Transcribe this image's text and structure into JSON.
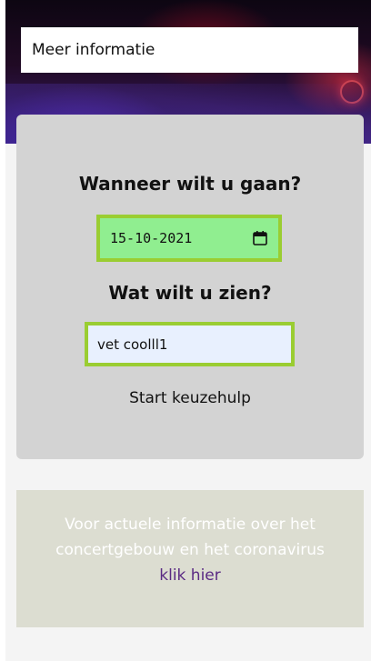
{
  "hero": {
    "more_info_label": "Meer informatie"
  },
  "search": {
    "date_question": "Wanneer wilt u gaan?",
    "date_value": "15-10-2021",
    "what_question": "Wat wilt u zien?",
    "what_value": "vet coolll1",
    "start_label": "Start keuzehulp",
    "colors": {
      "field_border": "#9acd32",
      "date_background": "#90ee90",
      "text_background": "#e8f0fe",
      "card_background": "#d3d3d3"
    }
  },
  "corona": {
    "text_line_1": "Voor actuele informatie over het concertgebouw en het coronavirus",
    "link_label": "klik hier",
    "colors": {
      "card_background": "#dcddd1",
      "link": "#5a2a83"
    }
  },
  "icons": {
    "date_picker": "calendar-icon"
  }
}
